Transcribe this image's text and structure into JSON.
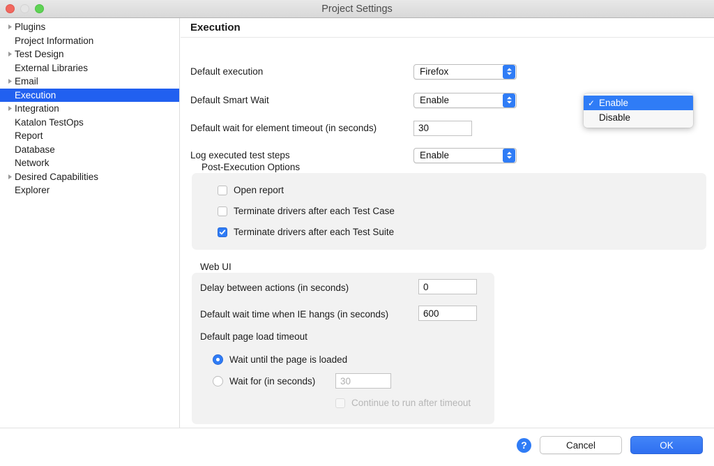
{
  "window": {
    "title": "Project Settings",
    "traffic_lights": [
      "close-button",
      "minimize-button",
      "zoom-button"
    ]
  },
  "sidebar": {
    "items": [
      {
        "label": "Plugins",
        "expandable": true,
        "selected": false
      },
      {
        "label": "Project Information",
        "expandable": false,
        "selected": false
      },
      {
        "label": "Test Design",
        "expandable": true,
        "selected": false
      },
      {
        "label": "External Libraries",
        "expandable": false,
        "selected": false
      },
      {
        "label": "Email",
        "expandable": true,
        "selected": false
      },
      {
        "label": "Execution",
        "expandable": false,
        "selected": true
      },
      {
        "label": "Integration",
        "expandable": true,
        "selected": false
      },
      {
        "label": "Katalon TestOps",
        "expandable": false,
        "selected": false
      },
      {
        "label": "Report",
        "expandable": false,
        "selected": false
      },
      {
        "label": "Database",
        "expandable": false,
        "selected": false
      },
      {
        "label": "Network",
        "expandable": false,
        "selected": false
      },
      {
        "label": "Desired Capabilities",
        "expandable": true,
        "selected": false
      },
      {
        "label": "Explorer",
        "expandable": false,
        "selected": false
      }
    ]
  },
  "content": {
    "heading": "Execution",
    "rows": {
      "default_execution": {
        "label": "Default execution",
        "value": "Firefox"
      },
      "default_smart_wait": {
        "label": "Default Smart Wait",
        "value": "Enable"
      },
      "element_timeout": {
        "label": "Default wait for element timeout (in seconds)",
        "value": "30"
      },
      "log_steps": {
        "label": "Log executed test steps",
        "value": "Enable"
      }
    },
    "dropdown_popup": {
      "open": true,
      "options": [
        {
          "label": "Enable",
          "checked": true,
          "highlighted": true
        },
        {
          "label": "Disable",
          "checked": false,
          "highlighted": false
        }
      ],
      "checkmark_glyph": "✓"
    },
    "post_execution": {
      "title": "Post-Execution Options",
      "options": [
        {
          "label": "Open report",
          "checked": false
        },
        {
          "label": "Terminate drivers after each Test Case",
          "checked": false
        },
        {
          "label": "Terminate drivers after each Test Suite",
          "checked": true
        }
      ]
    },
    "web_ui": {
      "title": "Web UI",
      "delay_between_actions": {
        "label": "Delay between actions (in seconds)",
        "value": "0"
      },
      "ie_hang_wait": {
        "label": "Default wait time when IE hangs (in seconds)",
        "value": "600"
      },
      "page_load_timeout": {
        "label": "Default page load timeout",
        "radios": [
          {
            "label": "Wait until the page is loaded",
            "selected": true
          },
          {
            "label": "Wait for (in seconds)",
            "selected": false
          }
        ],
        "wait_for_placeholder": "30",
        "continue_checkbox": {
          "label": "Continue to run after timeout",
          "checked": false,
          "disabled": true
        }
      }
    }
  },
  "footer": {
    "help_label": "?",
    "cancel_label": "Cancel",
    "ok_label": "OK"
  },
  "colors": {
    "accent": "#2f7cf6",
    "selection": "#2160f0",
    "group_bg": "#f2f2f2",
    "titlebar": "#e0e0e0"
  }
}
